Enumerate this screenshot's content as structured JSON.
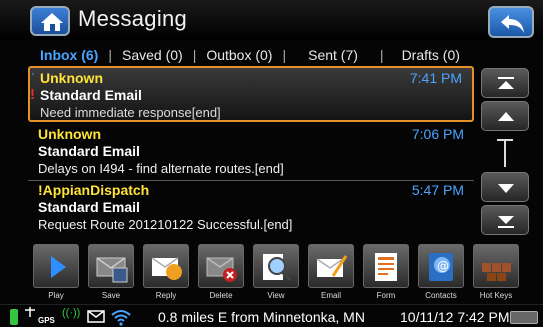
{
  "header": {
    "title": "Messaging",
    "home_icon": "home-icon",
    "back_icon": "back-arrow-icon"
  },
  "tabs": [
    {
      "label": "Inbox (6)",
      "active": true
    },
    {
      "label": "Saved (0)",
      "active": false
    },
    {
      "label": "Outbox (0)",
      "active": false
    },
    {
      "label": "Sent (7)",
      "active": false
    },
    {
      "label": "Drafts (0)",
      "active": false
    }
  ],
  "messages": [
    {
      "sender": "Unknown",
      "time": "7:41 PM",
      "type": "Standard Email",
      "body": "Need immediate response[end]",
      "selected": true,
      "unread_marker": "'",
      "alert_marker": "!"
    },
    {
      "sender": "Unknown",
      "time": "7:06 PM",
      "type": "Standard Email",
      "body": "Delays on I494 - find alternate routes.[end]",
      "selected": false
    },
    {
      "sender": "!AppianDispatch",
      "time": "5:47 PM",
      "type": "Standard Email",
      "body": "Request Route 201210122 Successful.[end]",
      "selected": false
    }
  ],
  "scroll": {
    "top_icon": "scroll-to-top-icon",
    "up_icon": "scroll-up-icon",
    "down_icon": "scroll-down-icon",
    "bottom_icon": "scroll-to-bottom-icon"
  },
  "toolbar": [
    {
      "label": "Play",
      "icon": "play-icon"
    },
    {
      "label": "Save",
      "icon": "save-icon"
    },
    {
      "label": "Reply",
      "icon": "reply-icon"
    },
    {
      "label": "Delete",
      "icon": "delete-icon"
    },
    {
      "label": "View",
      "icon": "view-icon"
    },
    {
      "label": "Email",
      "icon": "email-icon"
    },
    {
      "label": "Form",
      "icon": "form-icon"
    },
    {
      "label": "Contacts",
      "icon": "contacts-icon"
    },
    {
      "label": "Hot Keys",
      "icon": "hot-keys-icon"
    }
  ],
  "status": {
    "gps_label": "GPS",
    "signal": "((·))",
    "location": "0.8 miles E from Minnetonka, MN",
    "datetime": "10/11/12 7:42 PM",
    "colors": {
      "battery": "#35c640",
      "accent": "#4aa3ff",
      "sender": "#ffe23a",
      "selection": "#e6902a"
    }
  }
}
